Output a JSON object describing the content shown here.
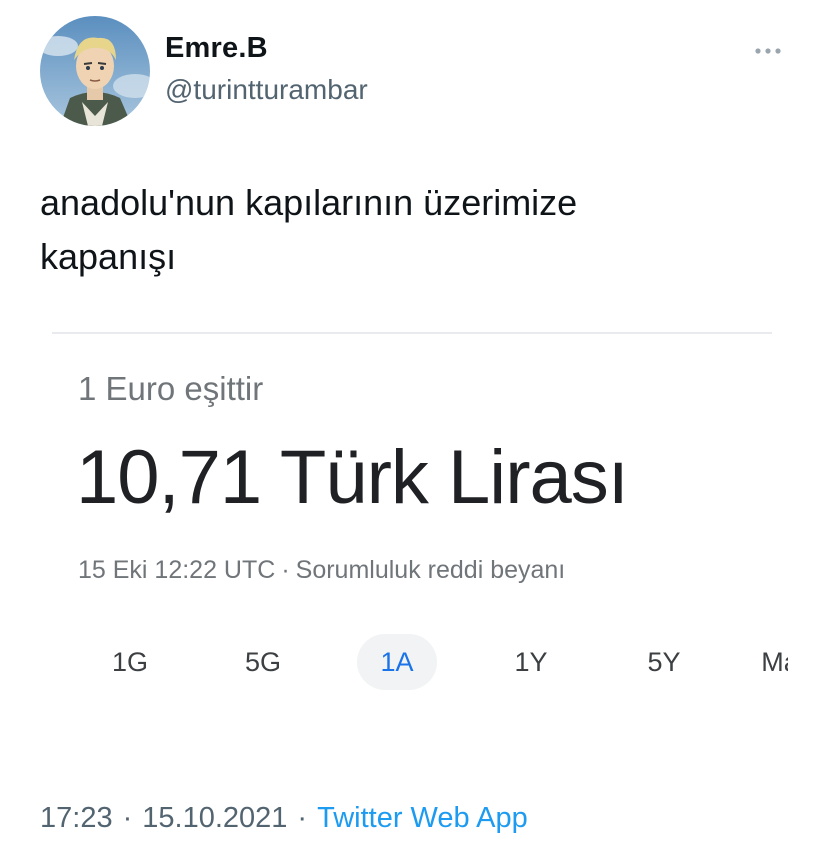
{
  "author": {
    "display_name": "Emre.B",
    "handle": "@turintturambar"
  },
  "tweet": {
    "text_line1": "anadolu'nun kapılarının üzerimize",
    "text_line2": "kapanışı"
  },
  "card": {
    "caption": "1 Euro eşittir",
    "amount": "10,71 Türk Lirası",
    "timestamp": "15 Eki 12:22 UTC",
    "separator": "·",
    "disclaimer": "Sorumluluk reddi beyanı",
    "ranges": [
      "1G",
      "5G",
      "1A",
      "1Y",
      "5Y",
      "Ma"
    ],
    "active_range": "1A"
  },
  "footer": {
    "time": "17:23",
    "date": "15.10.2021",
    "separator": "·",
    "source": "Twitter Web App"
  },
  "colors": {
    "link_blue": "#1d9bf0",
    "active_tab_blue": "#1a73e8",
    "muted_gray": "#536471"
  },
  "icons": {
    "more": "more-horizontal-icon",
    "avatar": "profile-avatar"
  }
}
